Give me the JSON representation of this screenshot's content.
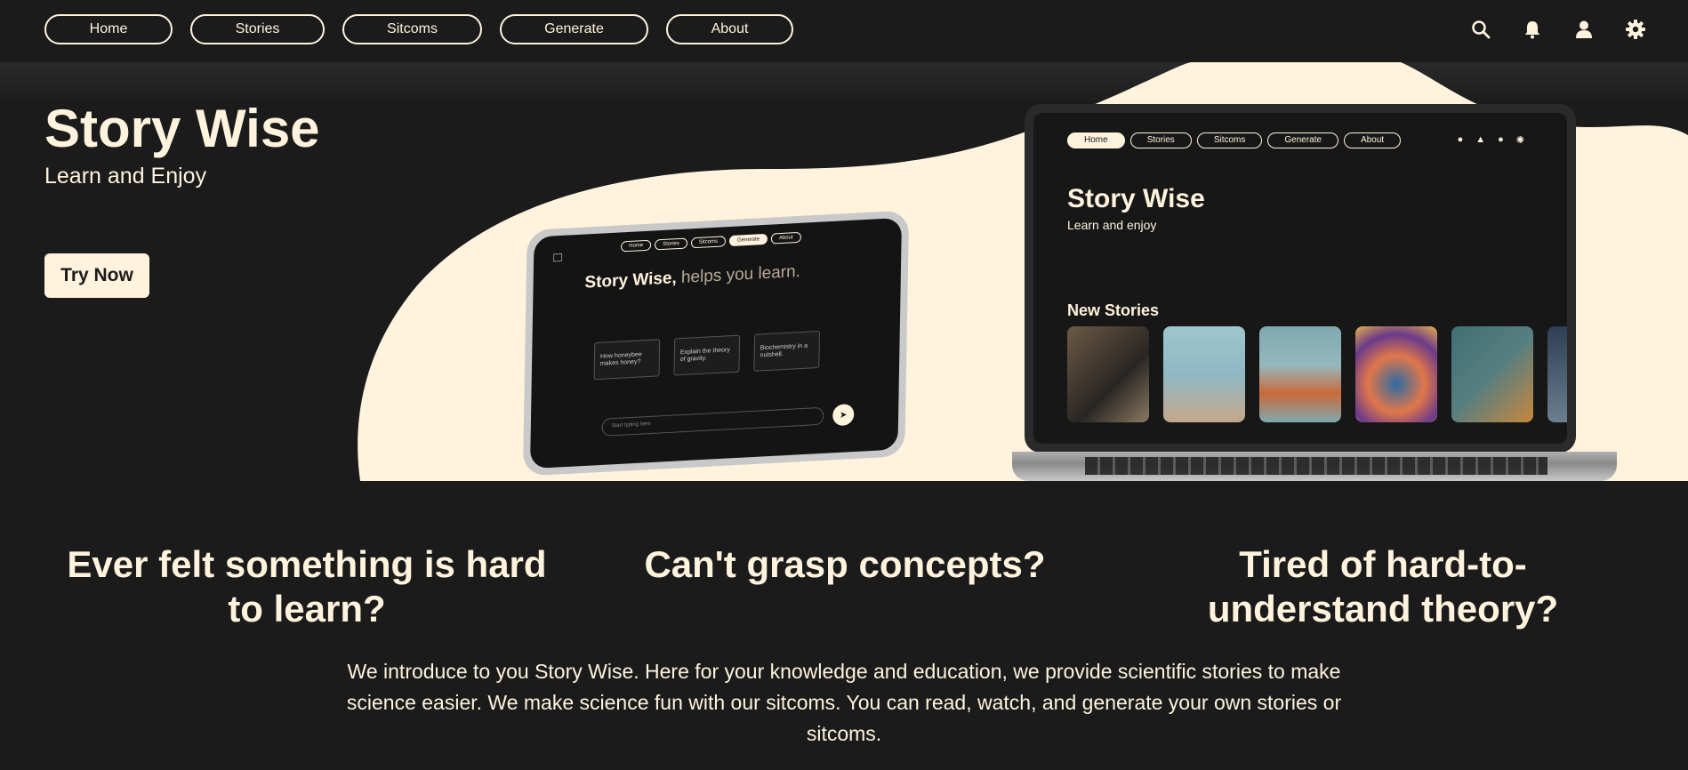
{
  "nav": {
    "items": [
      {
        "label": "Home"
      },
      {
        "label": "Stories"
      },
      {
        "label": "Sitcoms"
      },
      {
        "label": "Generate"
      },
      {
        "label": "About"
      }
    ],
    "icons": [
      "search-icon",
      "bell-icon",
      "user-icon",
      "gear-icon"
    ]
  },
  "hero": {
    "title": "Story Wise",
    "subtitle": "Learn and Enjoy",
    "cta": "Try Now"
  },
  "tablet_mock": {
    "nav": [
      "Home",
      "Stories",
      "Sitcoms",
      "Generate",
      "About"
    ],
    "active": "Generate",
    "headline_bold": "Story Wise,",
    "headline_rest": " helps you learn.",
    "cards": [
      "How honeybee makes honey?",
      "Explain the theory of gravity.",
      "Biochemistry in a nutshell."
    ],
    "input_placeholder": "Start typing here"
  },
  "laptop_mock": {
    "nav": [
      "Home",
      "Stories",
      "Sitcoms",
      "Generate",
      "About"
    ],
    "active": "Home",
    "title": "Story Wise",
    "subtitle": "Learn and enjoy",
    "section": "New Stories"
  },
  "questions": [
    "Ever felt something is hard to learn?",
    "Can't grasp concepts?",
    "Tired of hard-to-understand theory?"
  ],
  "intro": "We introduce to you Story Wise. Here for your knowledge and education, we provide scientific stories to make science easier. We make science fun with our sitcoms. You can read, watch, and generate your own stories or sitcoms.",
  "colors": {
    "background": "#1b1b1b",
    "accent_cream": "#fff3dd"
  }
}
